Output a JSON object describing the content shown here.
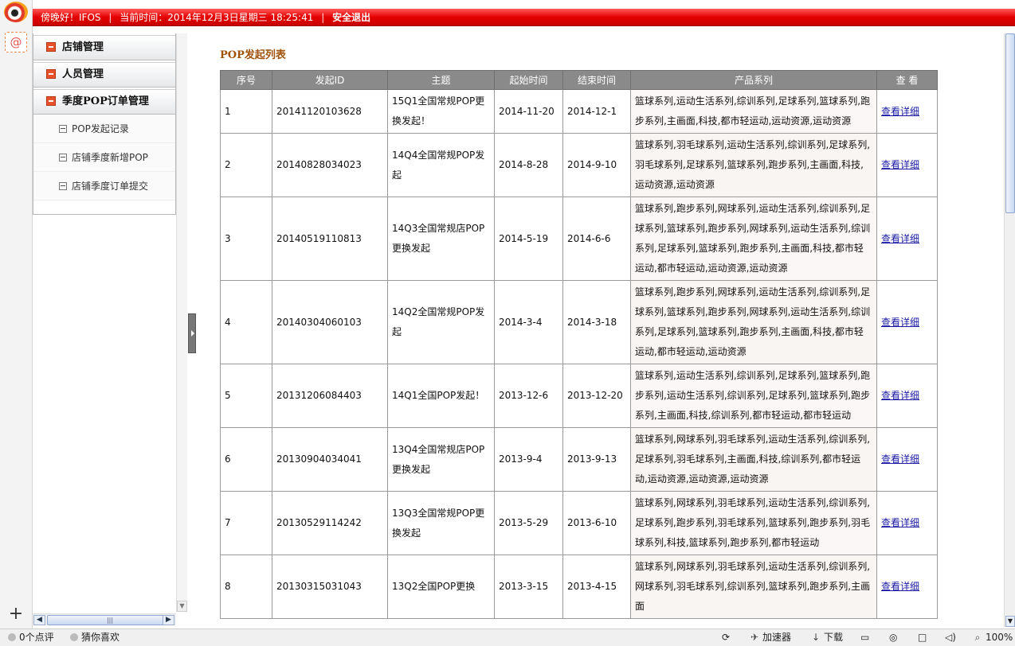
{
  "topbar": {
    "greeting": "傍晚好！IFOS",
    "time_text": "当前时间：2014年12月3日星期三  18:25:41",
    "logout": "安全退出"
  },
  "rail": {
    "at_glyph": "@",
    "add_glyph": "+"
  },
  "menu": {
    "heads": [
      "店铺管理",
      "人员管理",
      "季度POP订单管理"
    ],
    "subs": [
      "POP发起记录",
      "店铺季度新增POP",
      "店铺季度订单提交"
    ]
  },
  "main": {
    "title": "POP发起列表",
    "columns": [
      "序号",
      "发起ID",
      "主题",
      "起始时间",
      "结束时间",
      "产品系列",
      "查  看"
    ],
    "link_label": "查看详细",
    "rows": [
      {
        "no": "1",
        "id": "20141120103628",
        "subject": "15Q1全国常规POP更换发起！",
        "start": "2014-11-20",
        "end": "2014-12-1",
        "products": "篮球系列,运动生活系列,综训系列,足球系列,篮球系列,跑步系列,主画面,科技,都市轻运动,运动资源,运动资源"
      },
      {
        "no": "2",
        "id": "20140828034023",
        "subject": "14Q4全国常规POP发起",
        "start": "2014-8-28",
        "end": "2014-9-10",
        "products": "篮球系列,羽毛球系列,运动生活系列,综训系列,足球系列,羽毛球系列,足球系列,篮球系列,跑步系列,主画面,科技,运动资源,运动资源"
      },
      {
        "no": "3",
        "id": "20140519110813",
        "subject": "14Q3全国常规店POP更换发起",
        "start": "2014-5-19",
        "end": "2014-6-6",
        "products": "篮球系列,跑步系列,网球系列,运动生活系列,综训系列,足球系列,篮球系列,跑步系列,网球系列,运动生活系列,综训系列,足球系列,篮球系列,跑步系列,主画面,科技,都市轻运动,都市轻运动,运动资源,运动资源"
      },
      {
        "no": "4",
        "id": "20140304060103",
        "subject": "14Q2全国常规POP发起",
        "start": "2014-3-4",
        "end": "2014-3-18",
        "products": "篮球系列,跑步系列,网球系列,运动生活系列,综训系列,足球系列,篮球系列,跑步系列,网球系列,运动生活系列,综训系列,足球系列,篮球系列,跑步系列,主画面,科技,都市轻运动,都市轻运动,运动资源"
      },
      {
        "no": "5",
        "id": "20131206084403",
        "subject": "14Q1全国POP发起！",
        "start": "2013-12-6",
        "end": "2013-12-20",
        "products": "篮球系列,运动生活系列,综训系列,足球系列,篮球系列,跑步系列,运动生活系列,综训系列,足球系列,篮球系列,跑步系列,主画面,科技,综训系列,都市轻运动,都市轻运动"
      },
      {
        "no": "6",
        "id": "20130904034041",
        "subject": "13Q4全国常规店POP更换发起",
        "start": "2013-9-4",
        "end": "2013-9-13",
        "products": "篮球系列,网球系列,羽毛球系列,运动生活系列,综训系列,足球系列,羽毛球系列,主画面,科技,综训系列,都市轻运动,运动资源,运动资源,运动资源"
      },
      {
        "no": "7",
        "id": "20130529114242",
        "subject": "13Q3全国常规POP更换发起",
        "start": "2013-5-29",
        "end": "2013-6-10",
        "products": "篮球系列,网球系列,羽毛球系列,运动生活系列,综训系列,足球系列,跑步系列,羽毛球系列,篮球系列,跑步系列,羽毛球系列,科技,篮球系列,跑步系列,都市轻运动"
      },
      {
        "no": "8",
        "id": "20130315031043",
        "subject": "13Q2全国POP更换",
        "start": "2013-3-15",
        "end": "2013-4-15",
        "products": "篮球系列,网球系列,羽毛球系列,运动生活系列,综训系列,网球系列,羽毛球系列,综训系列,篮球系列,跑步系列,主画面"
      }
    ]
  },
  "status": {
    "comments": "0个点评",
    "guess": "猜你喜欢",
    "accelerator": "加速器",
    "download": "下载",
    "zoom": "100%"
  }
}
